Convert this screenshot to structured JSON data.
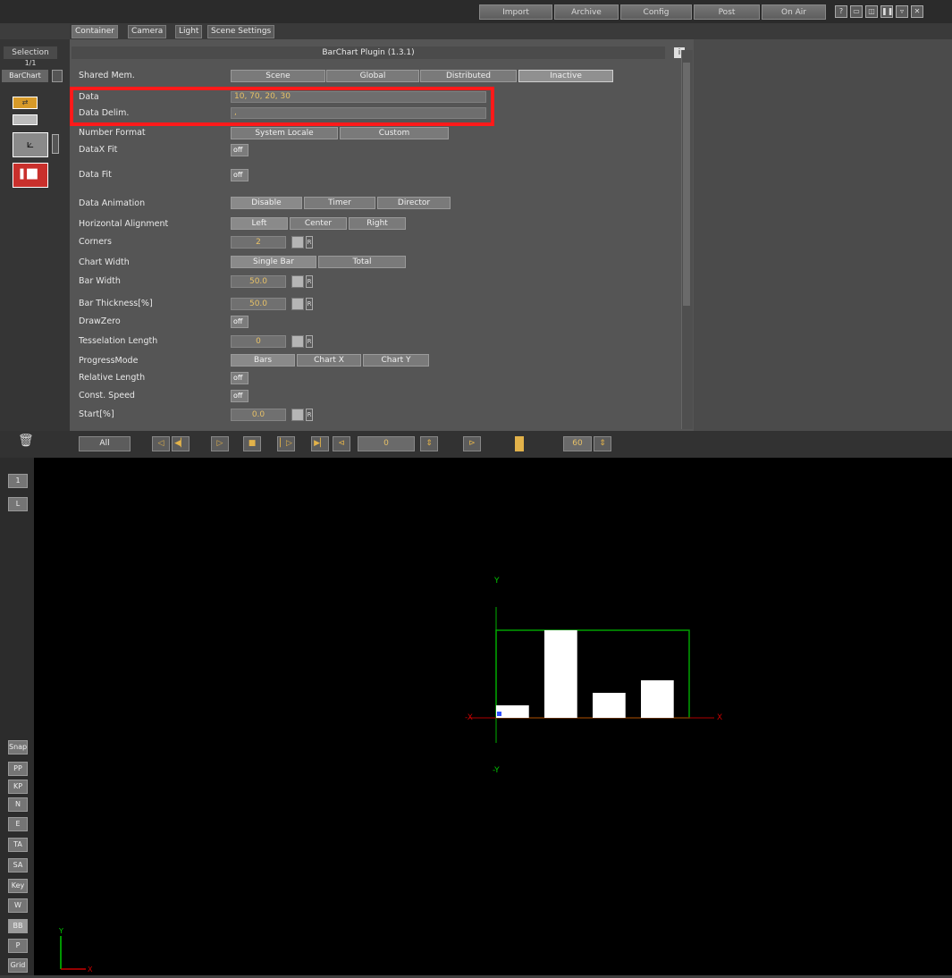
{
  "topbar": {
    "buttons": [
      "Import",
      "Archive",
      "Config",
      "Post",
      "On Air"
    ]
  },
  "tabs": [
    "Container",
    "Camera",
    "Light",
    "Scene Settings"
  ],
  "left": {
    "selection_label": "Selection",
    "selection_count": "1/1",
    "selected_item": "BarChart"
  },
  "panel": {
    "title": "BarChart Plugin (1.3.1)",
    "shared_mem": {
      "label": "Shared Mem.",
      "options": [
        "Scene",
        "Global",
        "Distributed",
        "Inactive"
      ]
    },
    "data": {
      "label": "Data",
      "value": "10, 70, 20, 30"
    },
    "data_delim": {
      "label": "Data Delim.",
      "value": ","
    },
    "number_format": {
      "label": "Number Format",
      "options": [
        "System Locale",
        "Custom"
      ]
    },
    "datax_fit": {
      "label": "DataX Fit",
      "value": "off"
    },
    "data_fit": {
      "label": "Data Fit",
      "value": "off"
    },
    "data_animation": {
      "label": "Data Animation",
      "options": [
        "Disable",
        "Timer",
        "Director"
      ]
    },
    "horizontal_alignment": {
      "label": "Horizontal Alignment",
      "options": [
        "Left",
        "Center",
        "Right"
      ]
    },
    "corners": {
      "label": "Corners",
      "value": "2"
    },
    "chart_width": {
      "label": "Chart Width",
      "options": [
        "Single Bar",
        "Total"
      ]
    },
    "bar_width": {
      "label": "Bar Width",
      "value": "50.0"
    },
    "bar_thickness": {
      "label": "Bar Thickness[%]",
      "value": "50.0"
    },
    "draw_zero": {
      "label": "DrawZero",
      "value": "off"
    },
    "tesselation_length": {
      "label": "Tesselation Length",
      "value": "0"
    },
    "progress_mode": {
      "label": "ProgressMode",
      "options": [
        "Bars",
        "Chart X",
        "Chart Y"
      ]
    },
    "relative_length": {
      "label": "Relative Length",
      "value": "off"
    },
    "const_speed": {
      "label": "Const. Speed",
      "value": "off"
    },
    "start": {
      "label": "Start[%]",
      "value": "0.0"
    }
  },
  "timeline": {
    "filter": "All",
    "frame": "0",
    "end_frame": "60"
  },
  "viewport": {
    "side_buttons": [
      "Snap",
      "PP",
      "KP",
      "N",
      "E",
      "TA",
      "SA",
      "Key",
      "W",
      "BB",
      "P",
      "Grid"
    ],
    "axis_labels": {
      "y": "Y",
      "neg_y": "-Y",
      "x": "X",
      "neg_x": "-X"
    }
  },
  "chart_data": {
    "type": "bar",
    "values": [
      10,
      70,
      20,
      30
    ],
    "ylim": [
      0,
      70
    ],
    "bar_color": "#ffffff",
    "frame_color": "#00a000"
  },
  "colors": {
    "highlight": "#ff1a1a",
    "value_text": "#e6c067"
  }
}
